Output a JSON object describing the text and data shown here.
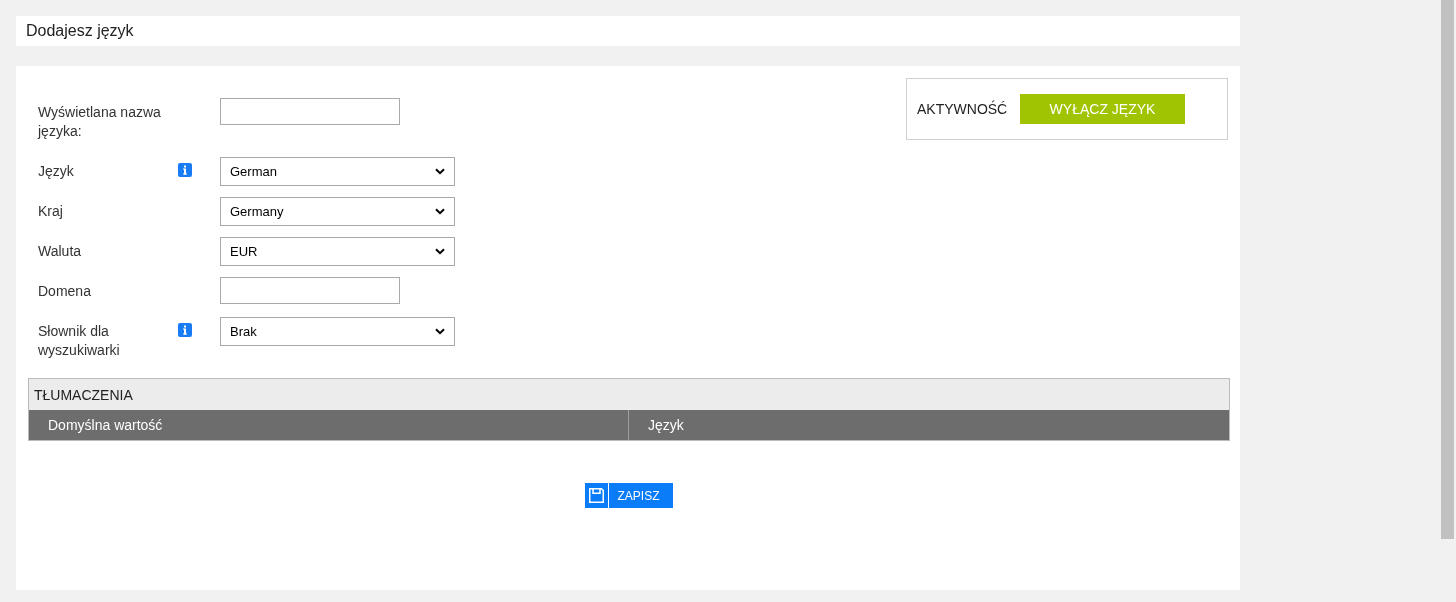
{
  "page": {
    "title": "Dodajesz język"
  },
  "form": {
    "fields": [
      {
        "kind": "text",
        "label": "Wyświetlana nazwa języka:",
        "info": false
      },
      {
        "kind": "select",
        "label": "Język",
        "info": true,
        "value": "German"
      },
      {
        "kind": "select",
        "label": "Kraj",
        "info": false,
        "value": "Germany"
      },
      {
        "kind": "select",
        "label": "Waluta",
        "info": false,
        "value": "EUR"
      },
      {
        "kind": "text",
        "label": "Domena",
        "info": false
      },
      {
        "kind": "select",
        "label": "Słownik dla wyszukiwarki",
        "info": true,
        "value": "Brak"
      }
    ]
  },
  "activity": {
    "label": "AKTYWNOŚĆ",
    "button": "WYŁĄCZ JĘZYK"
  },
  "translations": {
    "title": "TŁUMACZENIA",
    "columns": [
      "Domyślna wartość",
      "Język"
    ]
  },
  "save_button": {
    "label": "ZAPISZ"
  }
}
